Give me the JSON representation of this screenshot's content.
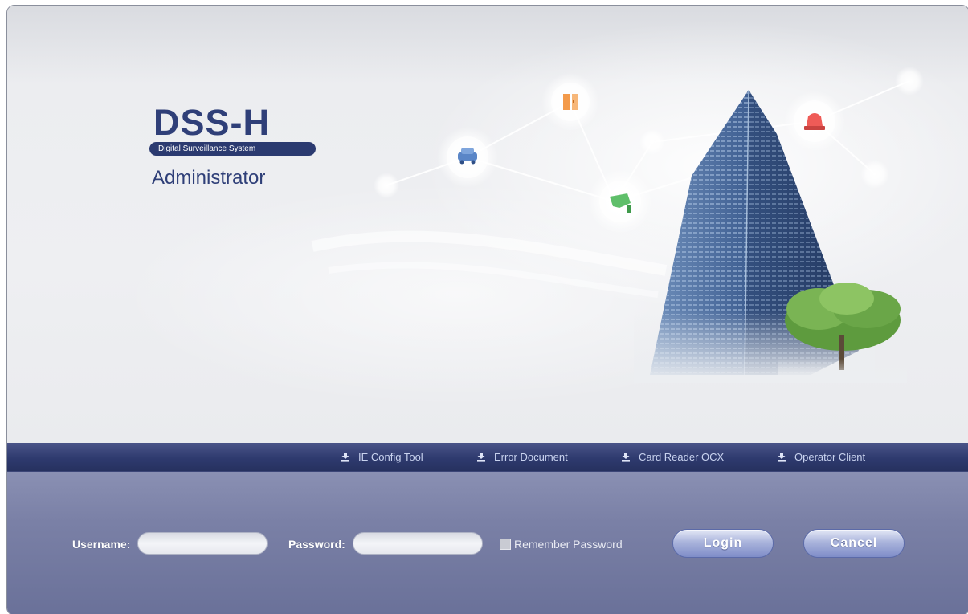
{
  "header": {
    "product_name": "DSS-H",
    "product_tagline": "Digital Surveillance System",
    "role": "Administrator"
  },
  "downloads": [
    {
      "label": "IE Config Tool",
      "icon": "download-icon"
    },
    {
      "label": "Error Document",
      "icon": "download-icon"
    },
    {
      "label": "Card Reader OCX",
      "icon": "download-icon"
    },
    {
      "label": "Operator Client",
      "icon": "download-icon"
    }
  ],
  "login": {
    "username_label": "Username:",
    "username_value": "",
    "password_label": "Password:",
    "password_value": "",
    "remember_label": "Remember Password",
    "remember_checked": false,
    "login_button": "Login",
    "cancel_button": "Cancel"
  },
  "illustration_icons": [
    "car-icon",
    "door-icon",
    "camera-icon",
    "alarm-icon"
  ],
  "colors": {
    "brand_navy": "#2f3f78",
    "link_bar": "#2e3a6e",
    "panel": "#7a80a6",
    "link_text": "#c9d3ef"
  }
}
